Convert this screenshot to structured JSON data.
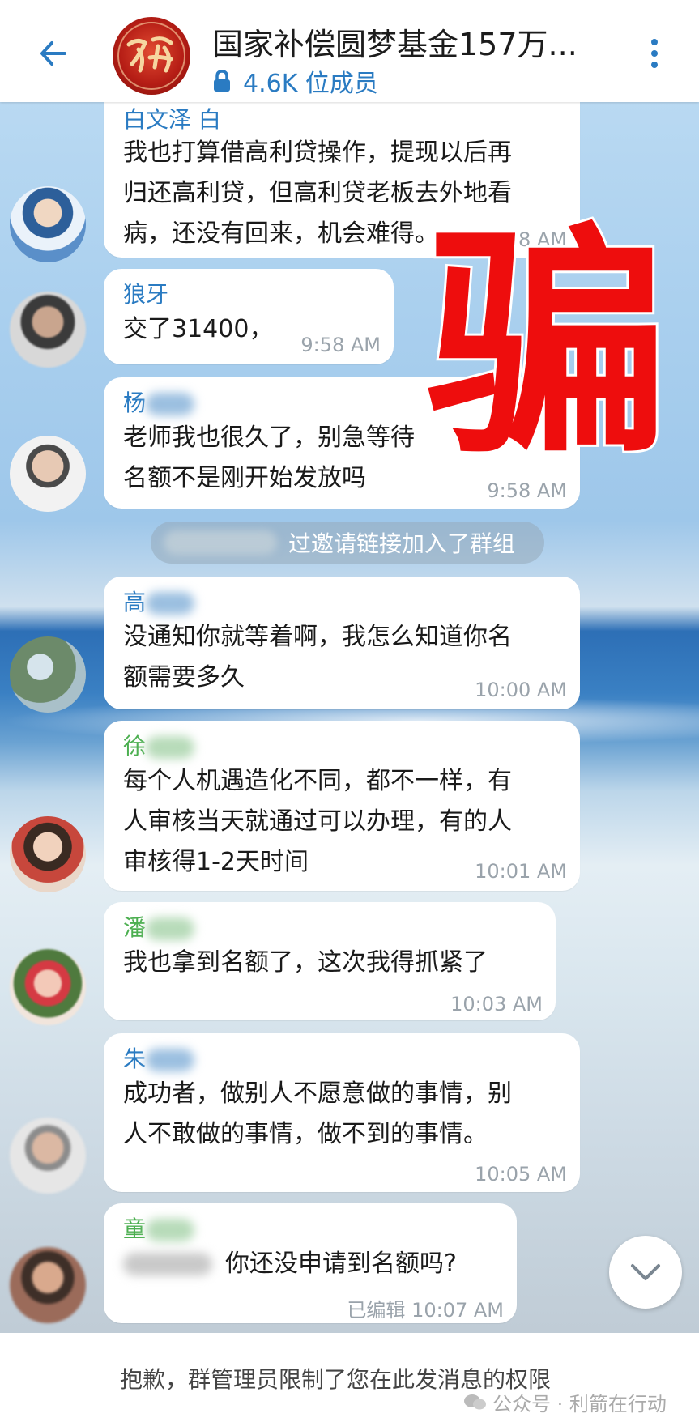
{
  "header": {
    "title": "国家补偿圆梦基金157万...",
    "member_count": "4.6K 位成员"
  },
  "messages": [
    {
      "sender": "白文泽 白",
      "sender_color": "#2a7bc2",
      "lines": [
        "我也打算借高利贷操作，提现以后再",
        "归还高利贷，但高利贷老板去外地看",
        "病，还没有回来，机会难得。"
      ],
      "time": "9:58 AM"
    },
    {
      "sender": "狼牙",
      "sender_color": "#2a7bc2",
      "lines": [
        "交了31400，"
      ],
      "time": "9:58 AM"
    },
    {
      "sender": "杨",
      "sender_color": "#2a7bc2",
      "lines": [
        "老师我也很久了，别急等待",
        "名额不是刚开始发放吗"
      ],
      "time": "9:58 AM"
    },
    {
      "sender": "高",
      "sender_color": "#2a7bc2",
      "lines": [
        "没通知你就等着啊，我怎么知道你名",
        "额需要多久"
      ],
      "time": "10:00 AM"
    },
    {
      "sender": "徐",
      "sender_color": "#4caf50",
      "lines": [
        "每个人机遇造化不同，都不一样，有",
        "人审核当天就通过可以办理，有的人",
        "审核得1-2天时间"
      ],
      "time": "10:01 AM"
    },
    {
      "sender": "潘",
      "sender_color": "#4caf50",
      "lines": [
        "我也拿到名额了，这次我得抓紧了"
      ],
      "time": "10:03 AM"
    },
    {
      "sender": "朱",
      "sender_color": "#2a7bc2",
      "lines": [
        "成功者，做别人不愿意做的事情，别",
        "人不敢做的事情，做不到的事情。"
      ],
      "time": "10:05 AM"
    },
    {
      "sender": "童",
      "sender_color": "#4caf50",
      "lines": [
        "你还没申请到名额吗?"
      ],
      "time": "10:07 AM",
      "edited": "已编辑"
    }
  ],
  "system_message": "过邀请链接加入了群组",
  "stamp_text": "骗",
  "footer": {
    "restriction": "抱歉，群管理员限制了您在此发消息的权限",
    "watermark": "公众号 · 利箭在行动"
  }
}
